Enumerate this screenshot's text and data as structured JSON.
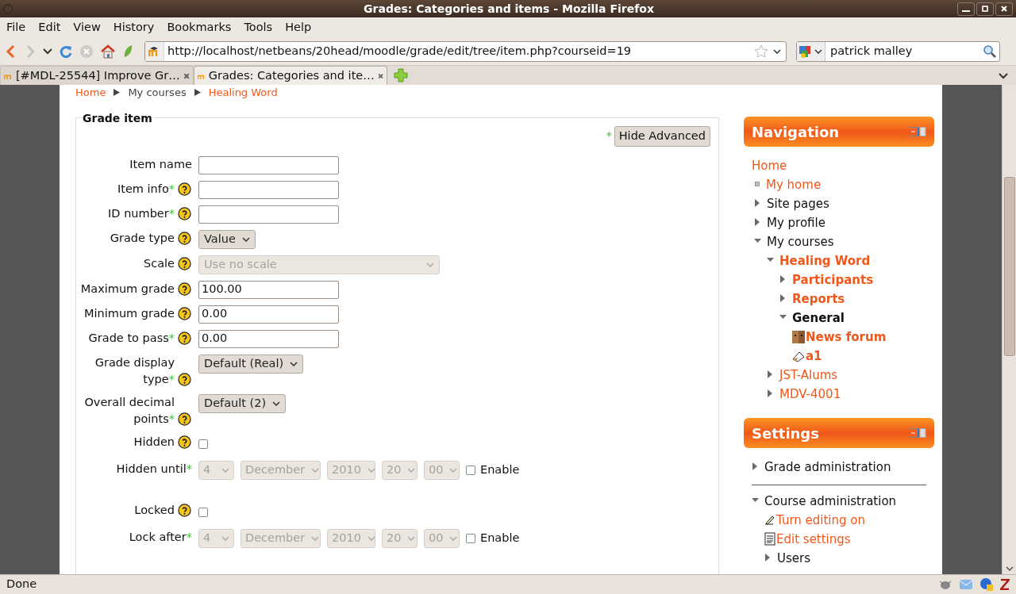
{
  "window": {
    "title": "Grades: Categories and items - Mozilla Firefox"
  },
  "menu": [
    "File",
    "Edit",
    "View",
    "History",
    "Bookmarks",
    "Tools",
    "Help"
  ],
  "address_bar": {
    "url": "http://localhost/netbeans/20head/moodle/grade/edit/tree/item.php?courseid=19"
  },
  "search": {
    "value": "patrick malley"
  },
  "tabs": [
    {
      "label": "[#MDL-25544] Improve Gr…",
      "selected": false
    },
    {
      "label": "Grades: Categories and ite…",
      "selected": true
    }
  ],
  "breadcrumb": [
    {
      "label": "Home",
      "link": true
    },
    {
      "label": "My courses",
      "link": false
    },
    {
      "label": "Healing Word",
      "link": true
    }
  ],
  "form": {
    "legend": "Grade item",
    "advanced_mark": "*",
    "advanced_button": "Hide Advanced",
    "fields": [
      {
        "kind": "text",
        "label": "Item name",
        "help": false
      },
      {
        "kind": "text",
        "label": "Item info",
        "mark": "*",
        "help": true
      },
      {
        "kind": "text",
        "label": "ID number",
        "mark": "*",
        "help": true
      },
      {
        "kind": "select",
        "label": "Grade type",
        "help": true,
        "value": "Value",
        "disabled": false
      },
      {
        "kind": "select",
        "label": "Scale",
        "help": true,
        "value": "Use no scale",
        "disabled": true
      },
      {
        "kind": "text",
        "label": "Maximum grade",
        "help": true,
        "value": "100.00"
      },
      {
        "kind": "text",
        "label": "Minimum grade",
        "help": true,
        "value": "0.00"
      },
      {
        "kind": "text",
        "label": "Grade to pass",
        "mark": "*",
        "help": true,
        "value": "0.00"
      },
      {
        "kind": "select",
        "label": "Grade display type",
        "mark": "*",
        "help": true,
        "value": "Default (Real)",
        "disabled": false
      },
      {
        "kind": "select",
        "label": "Overall decimal points",
        "mark": "*",
        "help": true,
        "value": "Default (2)",
        "disabled": false
      },
      {
        "kind": "checkbox",
        "label": "Hidden",
        "help": true,
        "checked": false
      },
      {
        "kind": "date",
        "label": "Hidden until",
        "mark": "*",
        "help": false,
        "parts": [
          "4",
          "December",
          "2010",
          "20",
          "00"
        ],
        "disabled": true,
        "enable": {
          "label": "Enable",
          "checked": false
        }
      },
      {
        "kind": "checkbox",
        "label": "Locked",
        "help": true,
        "checked": false
      },
      {
        "kind": "date",
        "label": "Lock after",
        "mark": "*",
        "help": false,
        "parts": [
          "4",
          "December",
          "2010",
          "20",
          "00"
        ],
        "disabled": true,
        "enable": {
          "label": "Enable",
          "checked": false
        }
      }
    ]
  },
  "navigation": {
    "title": "Navigation",
    "items": [
      {
        "kind": "root",
        "label": "Home",
        "link": true,
        "children": [
          {
            "kind": "bullet",
            "label": "My home",
            "link": true
          },
          {
            "kind": "branch",
            "label": "Site pages",
            "expanded": false
          },
          {
            "kind": "branch",
            "label": "My profile",
            "expanded": false
          },
          {
            "kind": "branch",
            "label": "My courses",
            "expanded": true,
            "children": [
              {
                "kind": "branch",
                "label": "Healing Word",
                "link": true,
                "emphasized": true,
                "expanded": true,
                "children": [
                  {
                    "kind": "branch",
                    "label": "Participants",
                    "link": true,
                    "emphasized": true,
                    "expanded": false
                  },
                  {
                    "kind": "branch",
                    "label": "Reports",
                    "link": true,
                    "emphasized": true,
                    "expanded": false
                  },
                  {
                    "kind": "branch",
                    "label": "General",
                    "emphasized": true,
                    "expanded": true,
                    "children": [
                      {
                        "kind": "forum",
                        "label": "News forum",
                        "link": true,
                        "emphasized": true
                      },
                      {
                        "kind": "assignment",
                        "label": "a1",
                        "link": true,
                        "emphasized": true
                      }
                    ]
                  }
                ]
              },
              {
                "kind": "branch",
                "label": "JST-Alums",
                "link": true,
                "expanded": false
              },
              {
                "kind": "branch",
                "label": "MDV-4001",
                "link": true,
                "expanded": false
              }
            ]
          }
        ]
      }
    ]
  },
  "settings": {
    "title": "Settings",
    "groups": [
      {
        "kind": "branch",
        "label": "Grade administration",
        "expanded": false
      },
      {
        "kind": "branch",
        "label": "Course administration",
        "expanded": true,
        "children": [
          {
            "kind": "edit",
            "label": "Turn editing on",
            "link": true
          },
          {
            "kind": "document",
            "label": "Edit settings",
            "link": true
          },
          {
            "kind": "branch",
            "label": "Users",
            "expanded": false
          }
        ]
      }
    ]
  },
  "status_bar": {
    "text": "Done"
  }
}
